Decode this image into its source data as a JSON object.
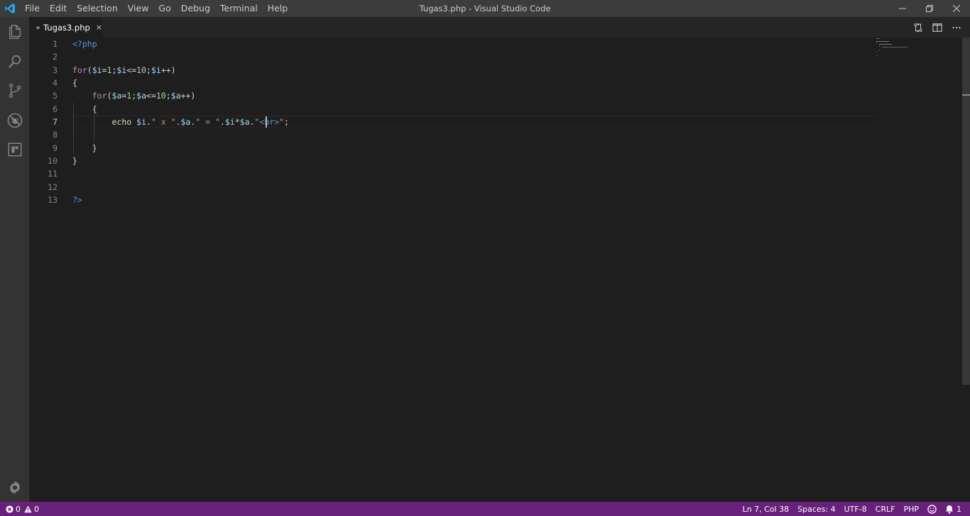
{
  "app": {
    "window_title": "Tugas3.php - Visual Studio Code"
  },
  "menu": {
    "items": [
      "File",
      "Edit",
      "Selection",
      "View",
      "Go",
      "Debug",
      "Terminal",
      "Help"
    ]
  },
  "activity_bar": {
    "icons": [
      "explorer-icon",
      "search-icon",
      "source-control-icon",
      "debug-icon",
      "extensions-icon"
    ],
    "bottom_icon": "gear-icon"
  },
  "tabs": [
    {
      "label": "Tugas3.php",
      "icon": "php-elephant-icon",
      "active": true,
      "close": "×"
    }
  ],
  "editor": {
    "line_numbers": [
      "1",
      "2",
      "3",
      "4",
      "5",
      "6",
      "7",
      "8",
      "9",
      "10",
      "11",
      "12",
      "13"
    ],
    "active_line": 7,
    "lines": [
      "<?php",
      "",
      "for($i=1;$i<=10;$i++)",
      "{",
      "    for($a=1;$a<=10;$a++)",
      "    {",
      "        echo $i.\" x \".$a.\" = \".$i*$a.\"<br>\";",
      "",
      "    }",
      "}",
      "",
      "",
      "?>"
    ]
  },
  "statusbar": {
    "errors": "0",
    "warnings": "0",
    "cursor_position": "Ln 7, Col 38",
    "indentation": "Spaces: 4",
    "encoding": "UTF-8",
    "line_ending": "CRLF",
    "language": "PHP",
    "notifications": "1"
  },
  "colors": {
    "statusbar": "#68217a",
    "titlebar": "#3c3c3c",
    "activitybar": "#333333",
    "editor_bg": "#1e1e1e",
    "accent": "#0e7ad3"
  }
}
